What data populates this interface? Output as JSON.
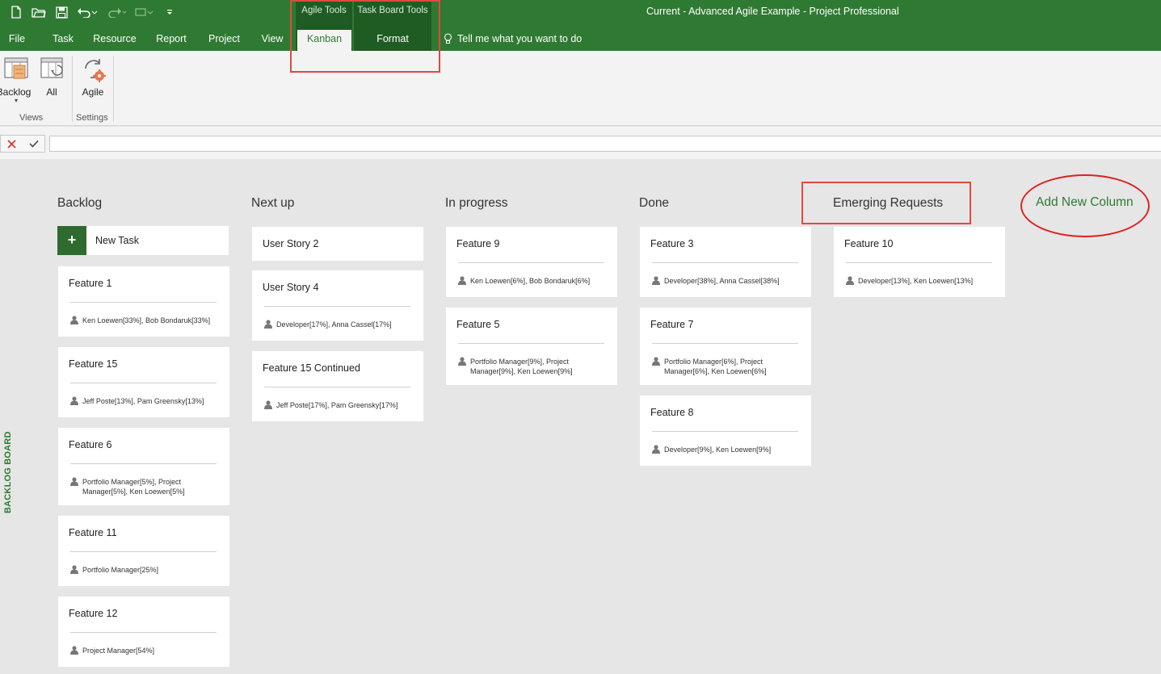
{
  "window": {
    "title": "Current - Advanced Agile Example  -  Project Professional"
  },
  "qat": {
    "icons": [
      "new-file-icon",
      "open-folder-icon",
      "save-icon",
      "undo-icon",
      "redo-icon",
      "more-icon",
      "customize-icon"
    ]
  },
  "context_groups": {
    "agile_tools": "Agile Tools",
    "task_board_tools": "Task Board Tools"
  },
  "tabs": [
    "File",
    "Task",
    "Resource",
    "Report",
    "Project",
    "View",
    "Kanban",
    "Format"
  ],
  "active_tab": "Kanban",
  "tell_me": "Tell me what you want to do",
  "ribbon": {
    "backlog_label": "Backlog",
    "all_label": "All",
    "agile_label": "Agile",
    "views_group": "Views",
    "settings_group": "Settings"
  },
  "board": {
    "vertical_label": "BACKLOG BOARD",
    "new_task": "New Task",
    "add_column": "Add New Column",
    "columns": [
      {
        "title": "Backlog",
        "cards": [
          {
            "title": "Feature 1",
            "resources": "Ken Loewen[33%], Bob Bondaruk[33%]"
          },
          {
            "title": "Feature 15",
            "resources": "Jeff Poste[13%], Pam Greensky[13%]"
          },
          {
            "title": "Feature 6",
            "resources": "Portfolio Manager[5%], Project Manager[5%], Ken Loewen[5%]"
          },
          {
            "title": "Feature 11",
            "resources": "Portfolio Manager[25%]"
          },
          {
            "title": "Feature 12",
            "resources": "Project Manager[54%]"
          }
        ]
      },
      {
        "title": "Next up",
        "cards": [
          {
            "title": "User Story 2",
            "resources": ""
          },
          {
            "title": "User Story 4",
            "resources": "Developer[17%], Anna Cassel[17%]"
          },
          {
            "title": "Feature 15 Continued",
            "resources": "Jeff Poste[17%], Pam Greensky[17%]"
          }
        ]
      },
      {
        "title": "In progress",
        "cards": [
          {
            "title": "Feature 9",
            "resources": "Ken Loewen[6%], Bob Bondaruk[6%]"
          },
          {
            "title": "Feature 5",
            "resources": "Portfolio Manager[9%], Project Manager[9%], Ken Loewen[9%]"
          }
        ]
      },
      {
        "title": "Done",
        "cards": [
          {
            "title": "Feature 3",
            "resources": "Developer[38%], Anna Cassel[38%]"
          },
          {
            "title": "Feature 7",
            "resources": "Portfolio Manager[6%], Project Manager[6%], Ken Loewen[6%]"
          },
          {
            "title": "Feature 8",
            "resources": "Developer[9%], Ken Loewen[9%]"
          }
        ]
      },
      {
        "title": "Emerging Requests",
        "cards": [
          {
            "title": "Feature 10",
            "resources": "Developer[13%], Ken Loewen[13%]"
          }
        ]
      }
    ]
  },
  "colors": {
    "ribbon_green": "#2f7a32",
    "context_green": "#1f5c23",
    "highlight_red": "#e04a3f",
    "board_bg": "#e6e6e6"
  }
}
